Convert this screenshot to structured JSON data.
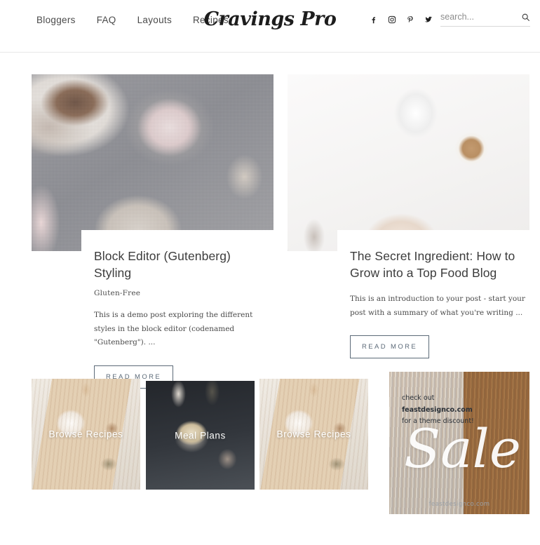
{
  "header": {
    "nav": [
      {
        "label": "Bloggers"
      },
      {
        "label": "FAQ"
      },
      {
        "label": "Layouts"
      },
      {
        "label": "Recipes"
      }
    ],
    "logo": "Cravings Pro",
    "social": [
      {
        "name": "facebook-icon",
        "label": "Facebook"
      },
      {
        "name": "instagram-icon",
        "label": "Instagram"
      },
      {
        "name": "pinterest-icon",
        "label": "Pinterest"
      },
      {
        "name": "twitter-icon",
        "label": "Twitter"
      }
    ],
    "search": {
      "placeholder": "search...",
      "value": "",
      "icon": "search-icon"
    }
  },
  "posts": [
    {
      "title": "Block Editor (Gutenberg) Styling",
      "category": "Gluten-Free",
      "excerpt": "This is a demo post exploring the different styles in the block editor (codenamed \"Gutenberg\"). ...",
      "read_more": "READ MORE",
      "image_alt": "mushrooms-and-pink-salt-photo"
    },
    {
      "title": "The Secret Ingredient: How to Grow into a Top Food Blog",
      "category": "",
      "excerpt": "This is an introduction to your post - start your post with a summary of what you're writing ...",
      "read_more": "READ MORE",
      "image_alt": "breakfast-bowl-and-coffee-photo"
    }
  ],
  "tiles": [
    {
      "label": "Browse Recipes",
      "image_alt": "wooden-board-bowl-photo"
    },
    {
      "label": "Meal Plans",
      "image_alt": "dark-noodle-bowl-photo"
    },
    {
      "label": "Browse Recipes",
      "image_alt": "wooden-board-bowl-photo"
    }
  ],
  "ad": {
    "line1": "check out",
    "line2": "feastdesignco.com",
    "line3": "for a theme discount!",
    "headline": "Sale",
    "footer": "feastdesignco.com",
    "image_alt": "granola-bars-on-marble-photo"
  },
  "colors": {
    "text": "#3c3c3c",
    "nav": "#4a4a4a",
    "button_border": "#5c6a78",
    "divider": "#e8e8e8"
  }
}
